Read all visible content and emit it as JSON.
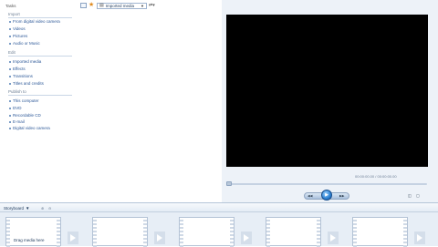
{
  "tasks": {
    "header": "Tasks",
    "sections": [
      {
        "title": "Import",
        "items": [
          "From digital video camera",
          "Videos",
          "Pictures",
          "Audio or Music"
        ]
      },
      {
        "title": "Edit",
        "items": [
          "Imported media",
          "Effects",
          "Transitions",
          "Titles and credits"
        ]
      },
      {
        "title": "Publish to",
        "items": [
          "This computer",
          "DVD",
          "Recordable CD",
          "E-mail",
          "Digital video camera"
        ]
      }
    ]
  },
  "toolbar": {
    "collection_value": "Imported media"
  },
  "preview": {
    "time": "00:00:00.00 / 00:00:00.00"
  },
  "storyboard": {
    "view_label": "Storyboard",
    "drop_hint": "Drag media here"
  },
  "colors": {
    "accent": "#2a7fd1",
    "monitor": "#000000",
    "panel": "#edf2f8"
  }
}
